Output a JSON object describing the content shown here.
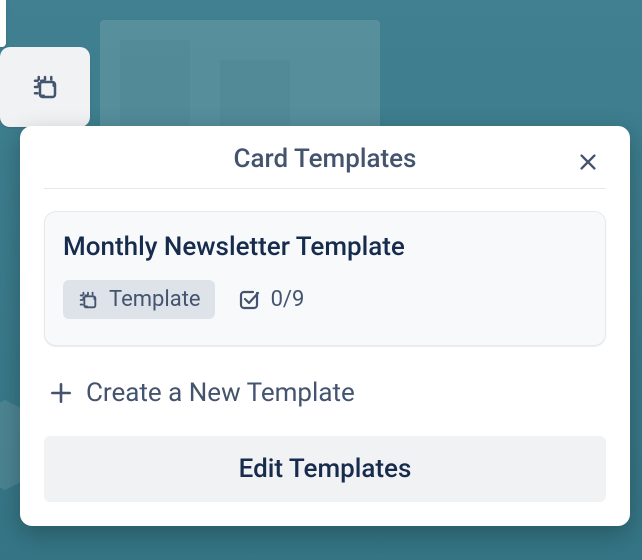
{
  "popover": {
    "title": "Card Templates",
    "template": {
      "name": "Monthly Newsletter Template",
      "badge_label": "Template",
      "checklist_count": "0/9"
    },
    "create_label": "Create a New Template",
    "edit_label": "Edit Templates"
  }
}
